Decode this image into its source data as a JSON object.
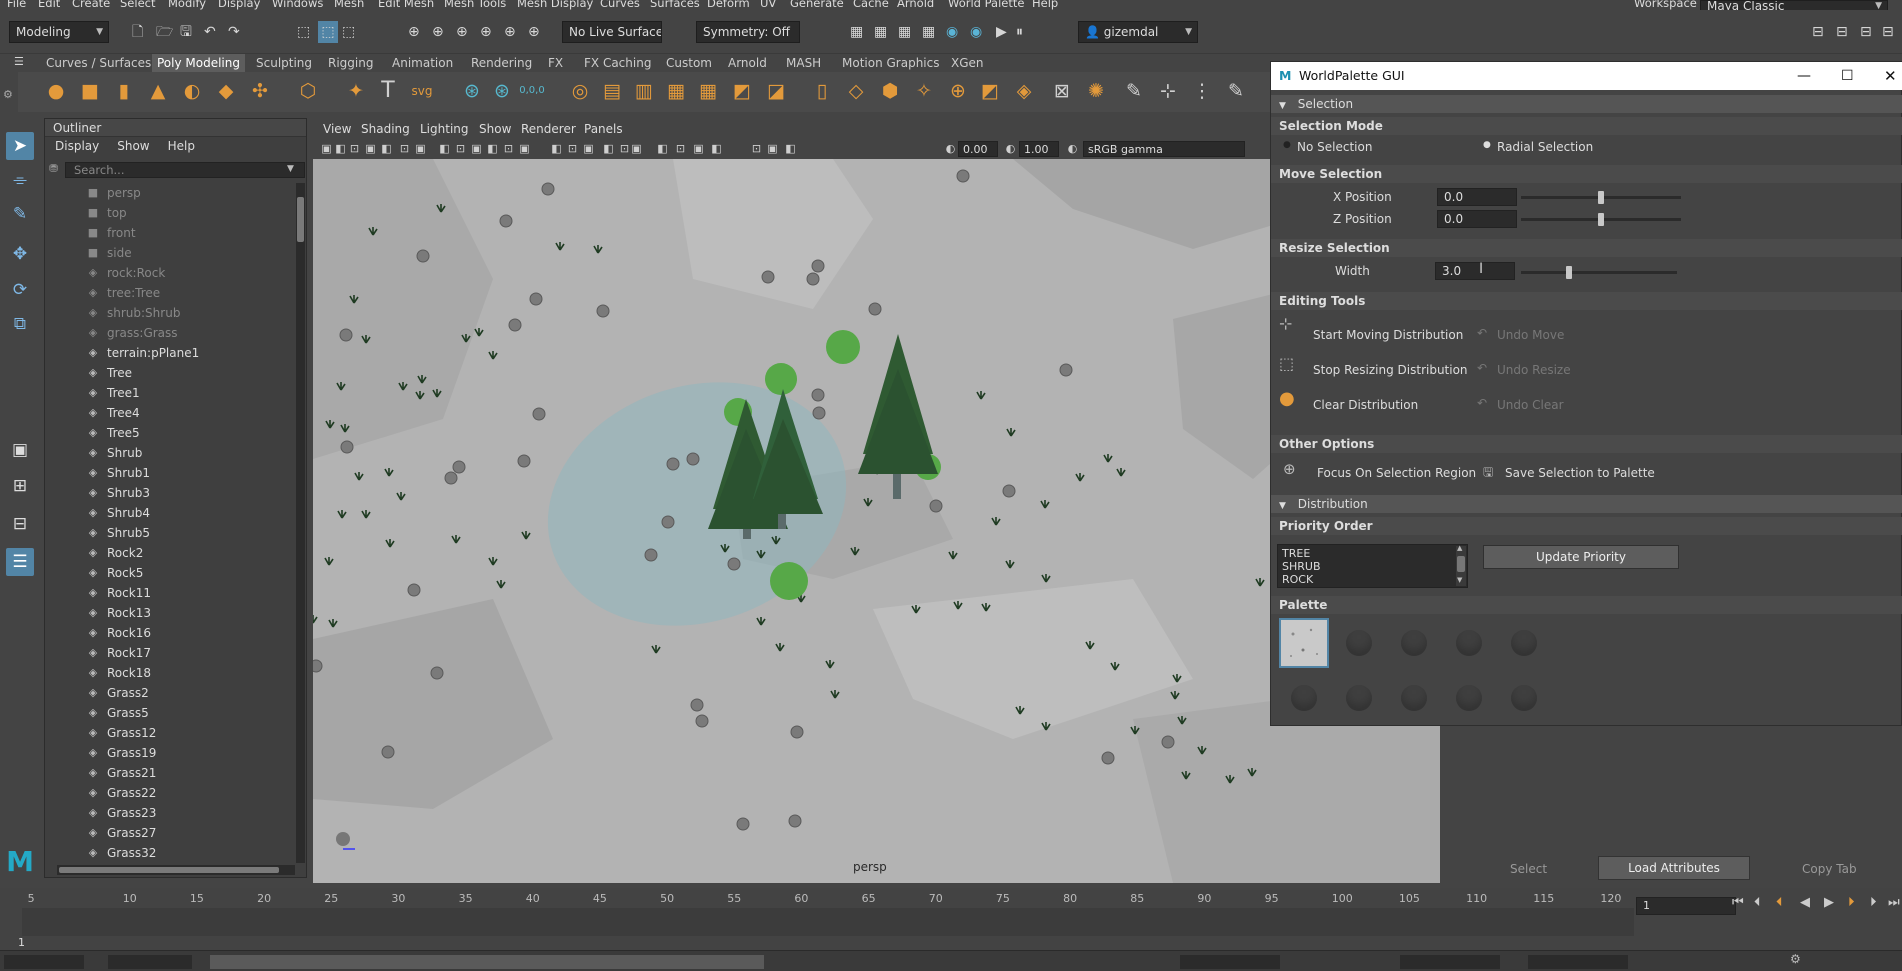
{
  "menus": [
    "File",
    "Edit",
    "Create",
    "Select",
    "Modify",
    "Display",
    "Windows",
    "Mesh",
    "Edit Mesh",
    "Mesh Tools",
    "Mesh Display",
    "Curves",
    "Surfaces",
    "Deform",
    "UV",
    "Generate",
    "Cache",
    "Arnold",
    "World Palette",
    "Help"
  ],
  "workspace": {
    "label": "Workspace :",
    "value": "Maya Classic"
  },
  "status": {
    "mode": "Modeling",
    "live_surface": "No Live Surface",
    "symmetry": "Symmetry: Off",
    "user": "gizemdal"
  },
  "shelf_tabs": [
    "Curves / Surfaces",
    "Poly Modeling",
    "Sculpting",
    "Rigging",
    "Animation",
    "Rendering",
    "FX",
    "FX Caching",
    "Custom",
    "Arnold",
    "MASH",
    "Motion Graphics",
    "XGen"
  ],
  "shelf_active": "Poly Modeling",
  "shelf_text_icons": {
    "text": "T",
    "svg": "svg",
    "coords": "0,0,0"
  },
  "outliner": {
    "title": "Outliner",
    "menu": [
      "Display",
      "Show",
      "Help"
    ],
    "search_placeholder": "Search...",
    "items": [
      {
        "name": "persp",
        "dim": true,
        "icon": "camera-icon"
      },
      {
        "name": "top",
        "dim": true,
        "icon": "camera-icon"
      },
      {
        "name": "front",
        "dim": true,
        "icon": "camera-icon"
      },
      {
        "name": "side",
        "dim": true,
        "icon": "camera-icon"
      },
      {
        "name": "rock:Rock",
        "dim": true,
        "icon": "transform-icon"
      },
      {
        "name": "tree:Tree",
        "dim": true,
        "icon": "transform-icon"
      },
      {
        "name": "shrub:Shrub",
        "dim": true,
        "icon": "transform-icon"
      },
      {
        "name": "grass:Grass",
        "dim": true,
        "icon": "transform-icon"
      },
      {
        "name": "terrain:pPlane1",
        "dim": false,
        "icon": "transform-icon"
      },
      {
        "name": "Tree",
        "dim": false,
        "icon": "transform-icon"
      },
      {
        "name": "Tree1",
        "dim": false,
        "icon": "transform-icon"
      },
      {
        "name": "Tree4",
        "dim": false,
        "icon": "transform-icon"
      },
      {
        "name": "Tree5",
        "dim": false,
        "icon": "transform-icon"
      },
      {
        "name": "Shrub",
        "dim": false,
        "icon": "transform-icon"
      },
      {
        "name": "Shrub1",
        "dim": false,
        "icon": "transform-icon"
      },
      {
        "name": "Shrub3",
        "dim": false,
        "icon": "transform-icon"
      },
      {
        "name": "Shrub4",
        "dim": false,
        "icon": "transform-icon"
      },
      {
        "name": "Shrub5",
        "dim": false,
        "icon": "transform-icon"
      },
      {
        "name": "Rock2",
        "dim": false,
        "icon": "transform-icon"
      },
      {
        "name": "Rock5",
        "dim": false,
        "icon": "transform-icon"
      },
      {
        "name": "Rock11",
        "dim": false,
        "icon": "transform-icon"
      },
      {
        "name": "Rock13",
        "dim": false,
        "icon": "transform-icon"
      },
      {
        "name": "Rock16",
        "dim": false,
        "icon": "transform-icon"
      },
      {
        "name": "Rock17",
        "dim": false,
        "icon": "transform-icon"
      },
      {
        "name": "Rock18",
        "dim": false,
        "icon": "transform-icon"
      },
      {
        "name": "Grass2",
        "dim": false,
        "icon": "transform-icon"
      },
      {
        "name": "Grass5",
        "dim": false,
        "icon": "transform-icon"
      },
      {
        "name": "Grass12",
        "dim": false,
        "icon": "transform-icon"
      },
      {
        "name": "Grass19",
        "dim": false,
        "icon": "transform-icon"
      },
      {
        "name": "Grass21",
        "dim": false,
        "icon": "transform-icon"
      },
      {
        "name": "Grass22",
        "dim": false,
        "icon": "transform-icon"
      },
      {
        "name": "Grass23",
        "dim": false,
        "icon": "transform-icon"
      },
      {
        "name": "Grass27",
        "dim": false,
        "icon": "transform-icon"
      },
      {
        "name": "Grass32",
        "dim": false,
        "icon": "transform-icon"
      }
    ]
  },
  "viewport": {
    "menu": [
      "View",
      "Shading",
      "Lighting",
      "Show",
      "Renderer",
      "Panels"
    ],
    "exposure": "0.00",
    "gamma": "1.00",
    "colorspace": "sRGB gamma",
    "camera_label": "persp"
  },
  "worldpalette": {
    "title": "WorldPalette GUI",
    "selection_header": "Selection",
    "selection_mode": "Selection Mode",
    "no_selection": "No Selection",
    "radial_selection": "Radial Selection",
    "move_selection": "Move Selection",
    "x_label": "X Position",
    "x_value": "0.0",
    "x_slider": 0.5,
    "z_label": "Z Position",
    "z_value": "0.0",
    "z_slider": 0.5,
    "resize_selection": "Resize Selection",
    "width_label": "Width",
    "width_value": "3.0",
    "width_slider": 0.3,
    "editing_tools": "Editing Tools",
    "start_moving": "Start Moving Distribution",
    "undo_move": "Undo Move",
    "stop_resizing": "Stop Resizing Distribution",
    "undo_resize": "Undo Resize",
    "clear_distribution": "Clear Distribution",
    "undo_clear": "Undo Clear",
    "other_options": "Other Options",
    "focus_region": "Focus On Selection Region",
    "save_selection": "Save Selection to Palette",
    "distribution_header": "Distribution",
    "priority_order": "Priority Order",
    "priority_items": [
      "TREE",
      "SHRUB",
      "ROCK"
    ],
    "update_priority": "Update Priority",
    "palette": "Palette"
  },
  "channel_box": {
    "select": "Select",
    "load_attributes": "Load Attributes",
    "copy_tab": "Copy Tab"
  },
  "timeline": {
    "ticks": [
      "5",
      "10",
      "15",
      "20",
      "25",
      "30",
      "35",
      "40",
      "45",
      "50",
      "55",
      "60",
      "65",
      "70",
      "75",
      "80",
      "85",
      "90",
      "95",
      "100",
      "105",
      "110",
      "115",
      "120"
    ],
    "start_frame": "1",
    "current_frame": "1"
  },
  "colors": {
    "accent": "#5285a6",
    "shelf_icon": "#e39a3b",
    "viewport_bg": "#b3b3b3",
    "tree": "#2f5a32",
    "shrub": "#57a848",
    "selection_region": "#8fb7bd"
  }
}
